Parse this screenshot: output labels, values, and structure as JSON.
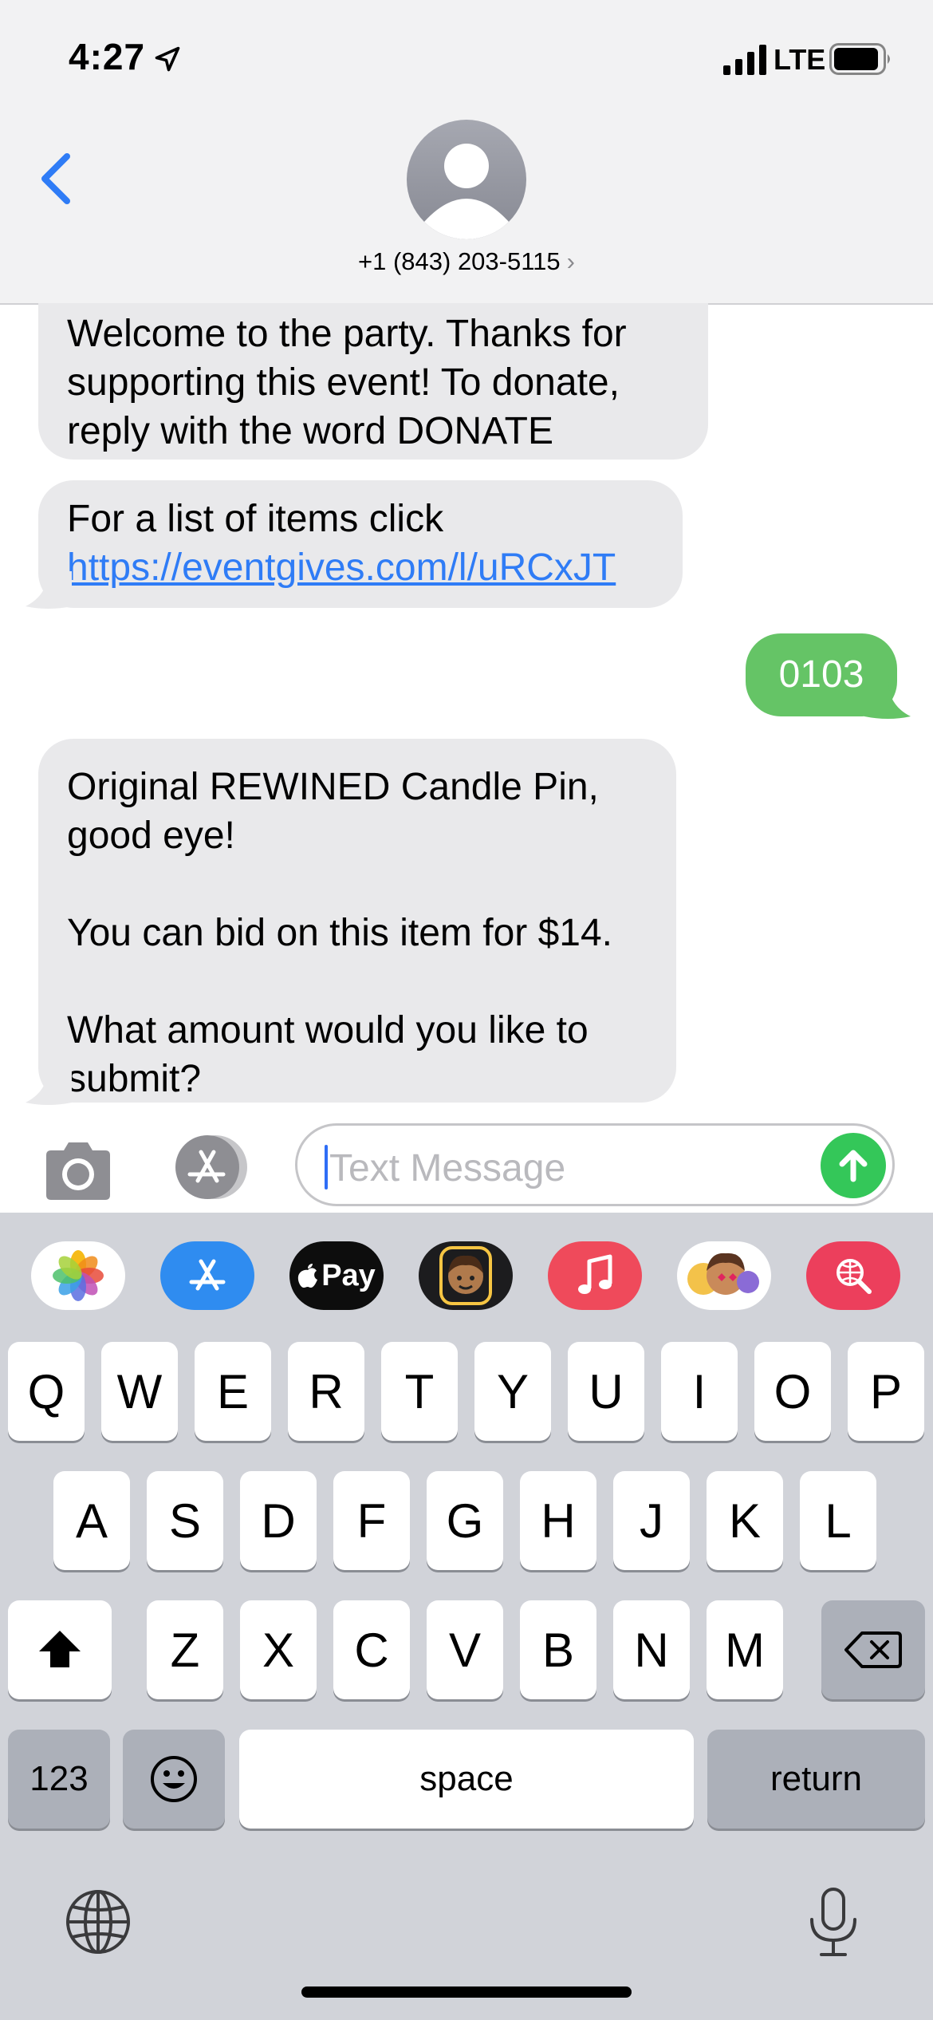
{
  "status_bar": {
    "time": "4:27",
    "network": "LTE"
  },
  "header": {
    "contact_number": "+1 (843) 203-5115",
    "chevron": "›"
  },
  "messages": [
    {
      "dir": "in",
      "text": "Welcome to the party. Thanks for\nsupporting this event! To donate,\nreply with the word DONATE"
    },
    {
      "dir": "in",
      "text": "For a list of items click",
      "link": "https://eventgives.com/l/uRCxJT"
    },
    {
      "dir": "out",
      "text": "0103"
    },
    {
      "dir": "in",
      "text": "Original REWINED Candle Pin,\ngood eye!\n\nYou can bid on this item for $14.\n\nWhat amount would you like to\nsubmit?"
    }
  ],
  "input": {
    "placeholder": "Text Message"
  },
  "app_strip": {
    "items": [
      "photos-app",
      "app-store-app",
      "apple-pay-app",
      "memoji-app",
      "music-app",
      "animoji-stickers-app",
      "image-search-app"
    ],
    "apple_pay_label": "Pay"
  },
  "keyboard": {
    "row1": [
      "Q",
      "W",
      "E",
      "R",
      "T",
      "Y",
      "U",
      "I",
      "O",
      "P"
    ],
    "row2": [
      "A",
      "S",
      "D",
      "F",
      "G",
      "H",
      "J",
      "K",
      "L"
    ],
    "row3": [
      "Z",
      "X",
      "C",
      "V",
      "B",
      "N",
      "M"
    ],
    "numbers_key": "123",
    "space_key": "space",
    "return_key": "return"
  },
  "colors": {
    "incoming_bubble": "#e9e9eb",
    "outgoing_bubble": "#65c466",
    "link": "#2f7cf6",
    "send": "#34c759",
    "back_chevron": "#2f7cf6"
  }
}
